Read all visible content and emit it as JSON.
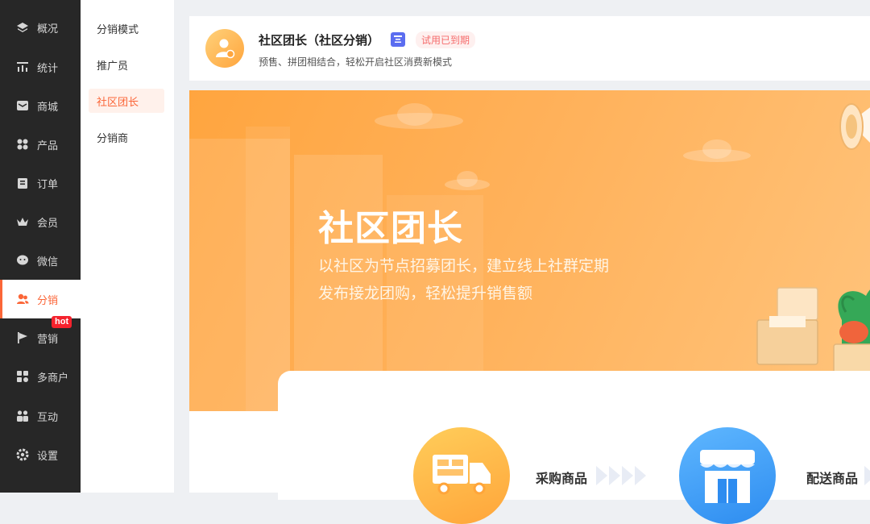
{
  "sidebar": {
    "items": [
      {
        "label": "概况",
        "icon": "layers-icon"
      },
      {
        "label": "统计",
        "icon": "chart-icon"
      },
      {
        "label": "商城",
        "icon": "mail-icon"
      },
      {
        "label": "产品",
        "icon": "grid-icon"
      },
      {
        "label": "订单",
        "icon": "clipboard-icon"
      },
      {
        "label": "会员",
        "icon": "crown-icon"
      },
      {
        "label": "微信",
        "icon": "chat-icon"
      },
      {
        "label": "分销",
        "icon": "users-icon"
      },
      {
        "label": "营销",
        "icon": "flag-icon"
      },
      {
        "label": "多商户",
        "icon": "store-icon"
      },
      {
        "label": "互动",
        "icon": "people-icon"
      },
      {
        "label": "设置",
        "icon": "gear-icon"
      }
    ],
    "active_index": 7,
    "hot_badge": "hot",
    "active_color": "#fb6638"
  },
  "submenu": {
    "items": [
      "分销模式",
      "推广员",
      "社区团长",
      "分销商"
    ],
    "active_index": 2
  },
  "header": {
    "title": "社区团长（社区分销）",
    "tag_icon": "app-tag-icon",
    "badge": "试用已到期",
    "description": "预售、拼团相结合，轻松开启社区消费新模式"
  },
  "banner": {
    "title": "社区团长",
    "line1": "以社区为节点招募团长，建立线上社群定期",
    "line2": "发布接龙团购，轻松提升销售额"
  },
  "steps": [
    {
      "label": "采购商品",
      "icon": "truck-icon"
    },
    {
      "label": "配送商品",
      "icon": "store-icon"
    }
  ]
}
